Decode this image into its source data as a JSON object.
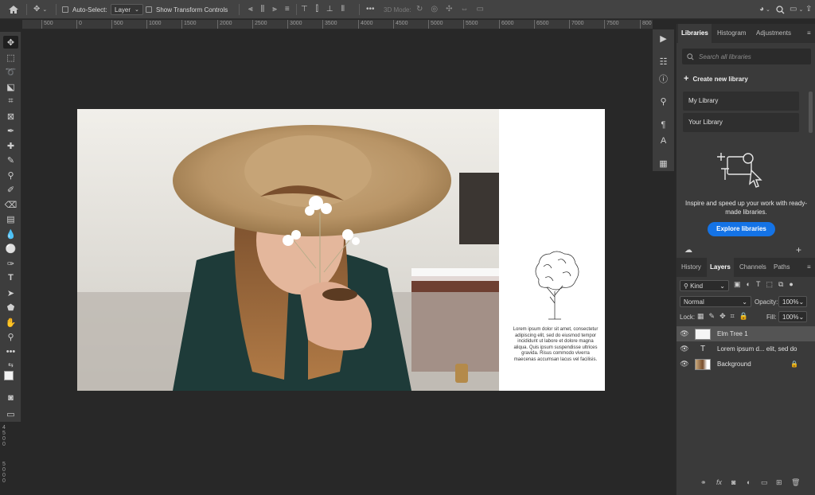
{
  "options_bar": {
    "auto_select_label": "Auto-Select:",
    "layer_select_value": "Layer",
    "transform_label": "Show Transform Controls",
    "mode_3d_label": "3D Mode:"
  },
  "ruler": {
    "ticks": [
      "500",
      "0",
      "500",
      "1000",
      "1500",
      "2000",
      "2500",
      "3000",
      "3500",
      "4000",
      "4500",
      "5000",
      "5500",
      "6000",
      "6500",
      "7000",
      "7500",
      "800"
    ],
    "vertical_labels": [
      "4500",
      "5000"
    ]
  },
  "canvas": {
    "caption": "Lorem ipsum dolor sit amet, consectetur adipiscing elit, sed do eiusmod tempor incididunt ut labore et dolore magna aliqua. Quis ipsum suspendisse ultrices gravida. Risus commodo viverra maecenas accumsan lacus vel facilisis."
  },
  "libraries_panel": {
    "tabs": [
      "Libraries",
      "Histogram",
      "Adjustments"
    ],
    "active_tab": "Libraries",
    "search_placeholder": "Search all libraries",
    "create_label": "Create new library",
    "items": [
      "My Library",
      "Your Library"
    ],
    "promo_text": "Inspire and speed up your work with ready-made libraries.",
    "explore_button": "Explore libraries"
  },
  "layers_panel": {
    "tabs": [
      "History",
      "Layers",
      "Channels",
      "Paths"
    ],
    "active_tab": "Layers",
    "filter_label": "Kind",
    "blend_mode": "Normal",
    "opacity_label": "Opacity:",
    "opacity_value": "100%",
    "lock_label": "Lock:",
    "fill_label": "Fill:",
    "fill_value": "100%",
    "layers": [
      {
        "name": "Elm Tree 1",
        "kind": "smart",
        "selected": true
      },
      {
        "name": "Lorem ipsum d... elit, sed do",
        "kind": "text",
        "selected": false
      },
      {
        "name": "Background",
        "kind": "image",
        "selected": false,
        "locked": true
      }
    ],
    "footer_fx": "fx"
  },
  "colors": {
    "accent": "#1473e6",
    "app_bg": "#282828",
    "panel_bg": "#3a3a3a"
  }
}
